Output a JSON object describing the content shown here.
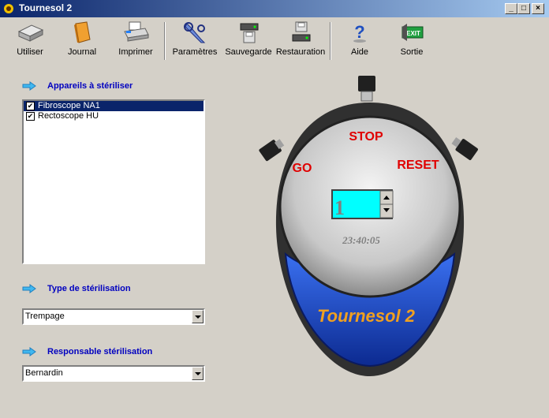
{
  "window": {
    "title": "Tournesol 2",
    "min_label": "_",
    "max_label": "□",
    "close_label": "×"
  },
  "toolbar": {
    "utiliser": "Utiliser",
    "journal": "Journal",
    "imprimer": "Imprimer",
    "parametres": "Paramètres",
    "sauvegarde": "Sauvegarde",
    "restauration": "Restauration",
    "aide": "Aide",
    "sortie": "Sortie",
    "exit_badge": "EXIT"
  },
  "sections": {
    "appareils": "Appareils à stériliser",
    "type": "Type de stérilisation",
    "responsable": "Responsable stérilisation"
  },
  "appareils_list": [
    {
      "label": "Fibroscope NA1",
      "checked": "✔"
    },
    {
      "label": "Rectoscope HU",
      "checked": "✔"
    }
  ],
  "type_select": {
    "value": "Trempage"
  },
  "responsable_select": {
    "value": "Bernardin"
  },
  "timer": {
    "stop": "STOP",
    "go": "GO",
    "reset": "RESET",
    "counter": "1",
    "clock": "23:40:05",
    "brand": "Tournesol 2"
  },
  "colors": {
    "accent_red": "#e00000",
    "brand_orange": "#f0a020",
    "blue_body": "#1e48c8",
    "counter_bg": "#00ffff"
  }
}
